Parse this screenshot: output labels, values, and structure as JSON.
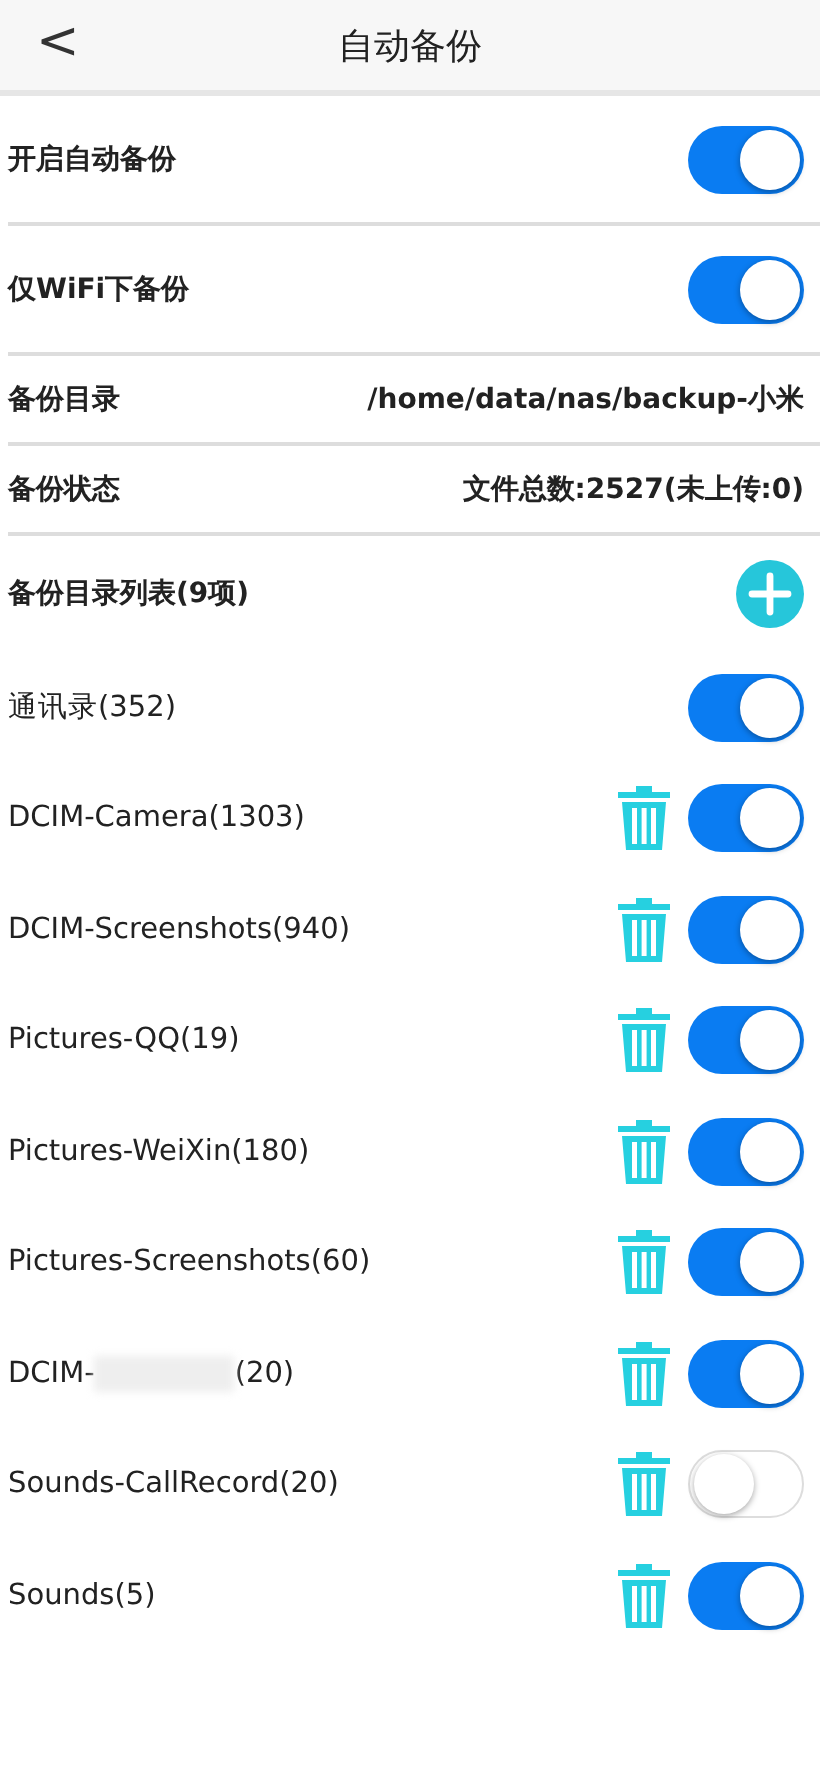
{
  "header": {
    "back": "<",
    "title": "自动备份"
  },
  "settings": [
    {
      "kind": "toggle",
      "label": "开启自动备份",
      "on": true
    },
    {
      "kind": "toggle",
      "label": "仅WiFi下备份",
      "on": true
    },
    {
      "kind": "value",
      "label": "备份目录",
      "value": "/home/data/nas/backup-小米"
    },
    {
      "kind": "value",
      "label": "备份状态",
      "value": "文件总数:2527(未上传:0)"
    }
  ],
  "list": {
    "title": "备份目录列表(9项)",
    "items": [
      {
        "label": "通讯录(352)",
        "deletable": false,
        "on": true
      },
      {
        "label": "DCIM-Camera(1303)",
        "deletable": true,
        "on": true
      },
      {
        "label": "DCIM-Screenshots(940)",
        "deletable": true,
        "on": true
      },
      {
        "label": "Pictures-QQ(19)",
        "deletable": true,
        "on": true
      },
      {
        "label": "Pictures-WeiXin(180)",
        "deletable": true,
        "on": true
      },
      {
        "label": "Pictures-Screenshots(60)",
        "deletable": true,
        "on": true
      },
      {
        "label": "DCIM-",
        "label_tail": "(20)",
        "deletable": true,
        "on": true
      },
      {
        "label": "Sounds-CallRecord(20)",
        "deletable": true,
        "on": false
      },
      {
        "label": "Sounds(5)",
        "deletable": true,
        "on": true
      }
    ]
  }
}
